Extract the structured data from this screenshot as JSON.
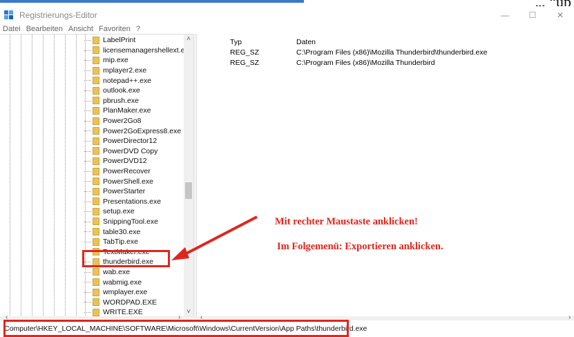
{
  "window": {
    "title": "Registrierungs-Editor",
    "controls": {
      "minimize": "—",
      "maximize": "☐",
      "close": "✕"
    }
  },
  "top_cut_text": "„, “up",
  "menu": [
    "Datei",
    "Bearbeiten",
    "Ansicht",
    "Favoriten",
    "?"
  ],
  "tree": {
    "items": [
      "LabelPrint",
      "licensemanagershellext.exe",
      "mip.exe",
      "mplayer2.exe",
      "notepad++.exe",
      "outlook.exe",
      "pbrush.exe",
      "PlanMaker.exe",
      "Power2Go8",
      "Power2GoExpress8.exe",
      "PowerDirector12",
      "PowerDVD Copy",
      "PowerDVD12",
      "PowerRecover",
      "PowerShell.exe",
      "PowerStarter",
      "Presentations.exe",
      "setup.exe",
      "SnippingTool.exe",
      "table30.exe",
      "TabTip.exe",
      "TextMaker.exe",
      "thunderbird.exe",
      "wab.exe",
      "wabmig.exe",
      "wmplayer.exe",
      "WORDPAD.EXE",
      "WRITE.EXE"
    ],
    "selected": "thunderbird.exe"
  },
  "values": {
    "headers": {
      "type": "Typ",
      "data": "Daten"
    },
    "rows": [
      {
        "type": "REG_SZ",
        "data": "C:\\Program Files (x86)\\Mozilla Thunderbird\\thunderbird.exe"
      },
      {
        "type": "REG_SZ",
        "data": "C:\\Program Files (x86)\\Mozilla Thunderbird"
      }
    ]
  },
  "annotations": {
    "line1": "Mit rechter Maustaste anklicken!",
    "line2": "Im Folgemenü: Exportieren anklicken.",
    "color": "#e0251c"
  },
  "status": {
    "path": "Computer\\HKEY_LOCAL_MACHINE\\SOFTWARE\\Microsoft\\Windows\\CurrentVersion\\App Paths\\thunderbird.exe"
  }
}
